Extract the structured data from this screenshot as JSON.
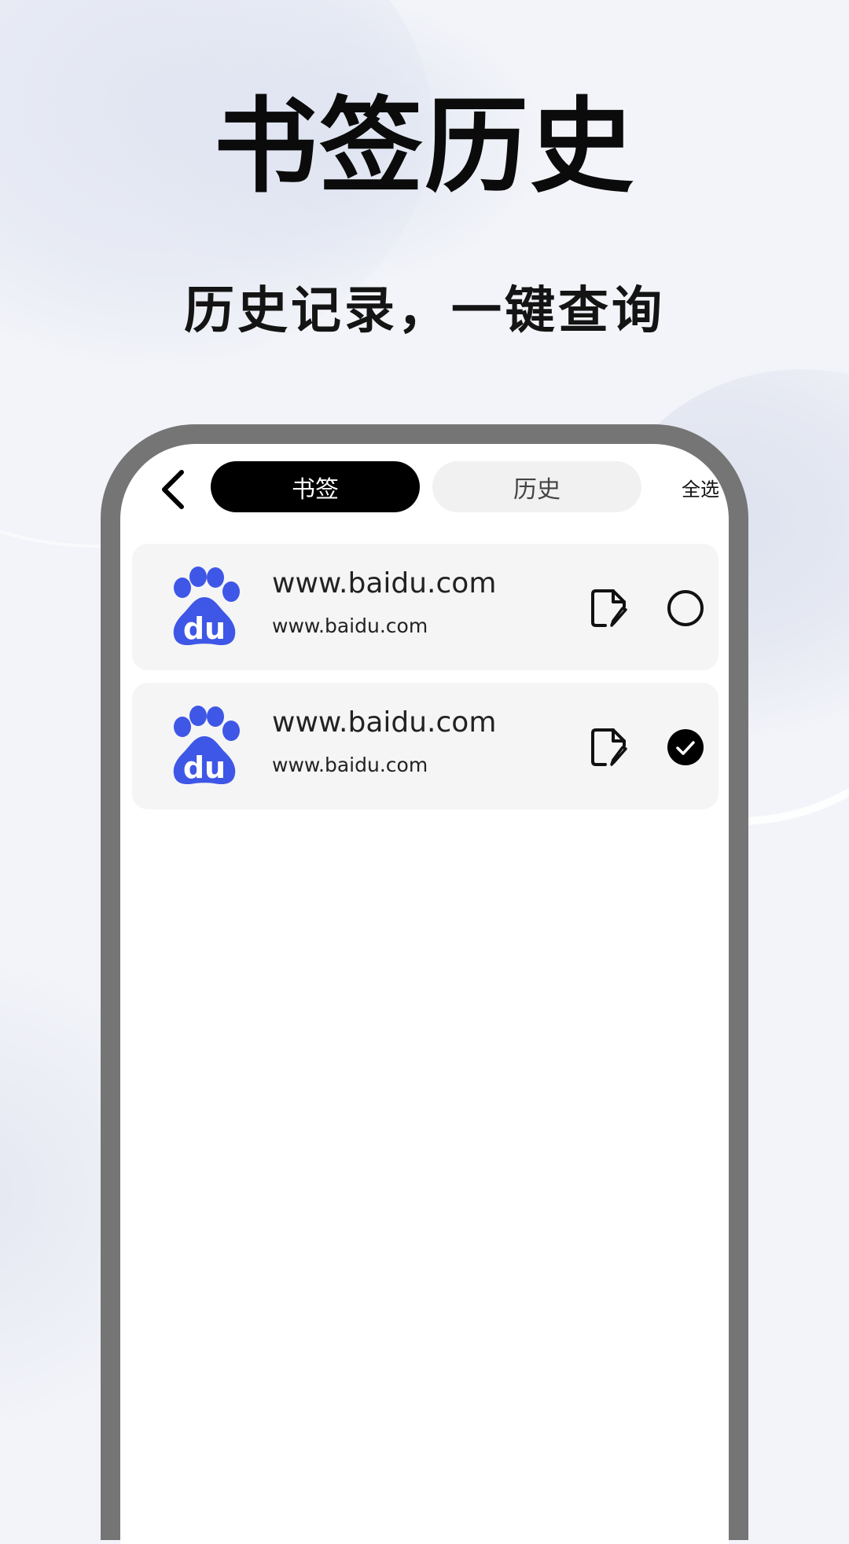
{
  "promo": {
    "title": "书签历史",
    "subtitle": "历史记录，一键查询"
  },
  "colors": {
    "background": "#f2f4f9",
    "phone_frame": "#757575",
    "card_bg": "#f5f5f5",
    "baidu_blue": "#3f57e6",
    "tab_active_bg": "#000000",
    "tab_inactive_bg": "#f1f1f1"
  },
  "header": {
    "back_icon": "chevron-left-icon",
    "tabs": [
      {
        "label": "书签",
        "active": true
      },
      {
        "label": "历史",
        "active": false
      }
    ],
    "select_all_label": "全选"
  },
  "items": [
    {
      "title": "www.baidu.com",
      "url": "www.baidu.com",
      "icon": "baidu-logo",
      "edit_icon": "edit-file-icon",
      "selected": false
    },
    {
      "title": "www.baidu.com",
      "url": "www.baidu.com",
      "icon": "baidu-logo",
      "edit_icon": "edit-file-icon",
      "selected": true
    }
  ]
}
